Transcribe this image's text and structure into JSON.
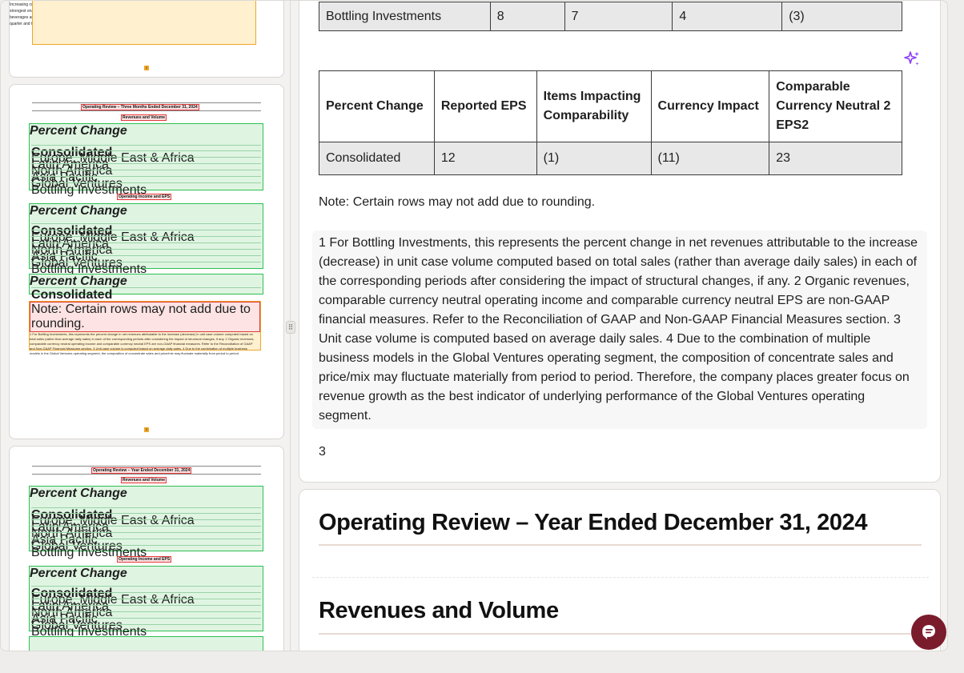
{
  "colors": {
    "accent_chat": "#7a1c2c",
    "sparkle": "#8a3ffc",
    "highlight_green": "#2fbf54",
    "highlight_red": "#e03a3a",
    "highlight_orange": "#f0a52a"
  },
  "icons": {
    "sparkle": "sparkle-icon",
    "chat": "chat-bubble-icon",
    "handle": "drag-handle-icon"
  },
  "thumbs": {
    "top_fragment": "unit case volume grew in both quarter... adding more than 250,000 net new outlets and nearly 600,000 new coolers. Increasing cold-drink equipment is critical to drive transactions and expand the consumer base, as coolers are one of the strongest enablers for transaction growth, especially in traditional trade channels where approximately 90% of NARTD beverages are served cold. These actions contributed to the company growing volume and gaining value share for both the quarter and the full year.",
    "top_page_no": "2",
    "p3": {
      "title": "Operating Review – Three Months Ended December 31, 2024",
      "sec1": "Revenues and Volume",
      "sec2": "Operating Income and EPS",
      "col_pc": "Percent Change",
      "rows1": [
        "Consolidated",
        "Europe, Middle East & Africa",
        "Latin America",
        "North America",
        "Asia Pacific",
        "Global Ventures",
        "Bottling Investments"
      ],
      "rows2": [
        "Consolidated",
        "Europe, Middle East & Africa",
        "Latin America",
        "North America",
        "Asia Pacific",
        "Global Ventures",
        "Bottling Investments"
      ],
      "rows3": [
        "Consolidated"
      ],
      "note": "Note: Certain rows may not add due to rounding.",
      "fn": "1 For Bottling Investments, this represents the percent change in net revenues attributable to the increase (decrease) in unit case volume computed based on total sales (rather than average daily sales) in each of the corresponding periods after considering the impact of structural changes, if any. 2 Organic revenues, comparable currency neutral operating income and comparable currency neutral EPS are non-GAAP financial measures. Refer to the Reconciliation of GAAP and Non-GAAP Financial Measures section. 3 Unit case volume is computed based on average daily sales. 4 Due to the combination of multiple business models in the Global Ventures operating segment, the composition of concentrate sales and price/mix may fluctuate materially from period to period.",
      "page_no": "3"
    },
    "p4": {
      "title": "Operating Review – Year Ended December 31, 2024",
      "sec1": "Revenues and Volume",
      "sec2": "Operating Income and EPS",
      "col_pc": "Percent Change",
      "rows1": [
        "Consolidated",
        "Europe, Middle East & Africa",
        "Latin America",
        "North America",
        "Asia Pacific",
        "Global Ventures",
        "Bottling Investments"
      ],
      "rows2": [
        "Consolidated",
        "Europe, Middle East & Africa",
        "Latin America",
        "North America",
        "Asia Pacific",
        "Global Ventures",
        "Bottling Investments"
      ]
    }
  },
  "main": {
    "top_row": [
      "Bottling Investments",
      "8",
      "7",
      "4",
      "(3)"
    ],
    "eps_table": {
      "headers": [
        "Percent Change",
        "Reported EPS",
        "Items Impacting Comparability",
        "Currency Impact",
        "Comparable Currency Neutral 2 EPS2"
      ],
      "row": [
        "Consolidated",
        "12",
        "(1)",
        "(11)",
        "23"
      ]
    },
    "note": "Note: Certain rows may not add due to rounding.",
    "footnotes": "1 For Bottling Investments, this represents the percent change in net revenues attributable to the increase (decrease) in unit case volume computed based on total sales (rather than average daily sales) in each of the corresponding periods after considering the impact of structural changes, if any. 2 Organic revenues, comparable currency neutral operating income and comparable currency neutral EPS are non-GAAP financial measures. Refer to the Reconciliation of GAAP and Non-GAAP Financial Measures section. 3 Unit case volume is computed based on average daily sales. 4 Due to the combination of multiple business models in the Global Ventures operating segment, the composition of concentrate sales and price/mix may fluctuate materially from period to period. Therefore, the company places greater focus on revenue growth as the best indicator of underlying performance of the Global Ventures operating segment.",
    "page_number": "3",
    "heading1": "Operating Review – Year Ended December 31, 2024",
    "heading2": "Revenues and Volume"
  }
}
